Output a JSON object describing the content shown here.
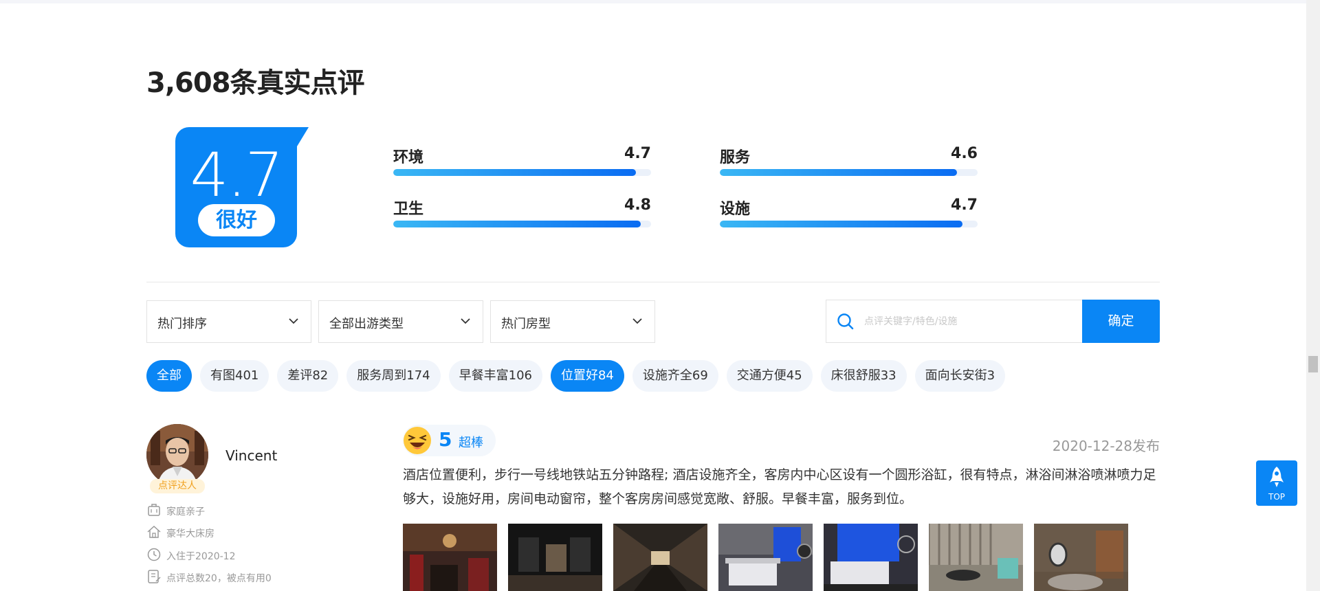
{
  "header": {
    "title": "3,608条真实点评"
  },
  "overall": {
    "score": "4.7",
    "label": "很好"
  },
  "subscores": [
    {
      "name": "环境",
      "value": "4.7",
      "fill": 0.94
    },
    {
      "name": "服务",
      "value": "4.6",
      "fill": 0.92
    },
    {
      "name": "卫生",
      "value": "4.8",
      "fill": 0.96
    },
    {
      "name": "设施",
      "value": "4.7",
      "fill": 0.94
    }
  ],
  "filters": {
    "sort": "热门排序",
    "travel_type": "全部出游类型",
    "room_type": "热门房型"
  },
  "search": {
    "placeholder": "点评关键字/特色/设施",
    "confirm_label": "确定"
  },
  "tags": [
    {
      "label": "全部",
      "active": true
    },
    {
      "label": "有图401",
      "active": false
    },
    {
      "label": "差评82",
      "active": false
    },
    {
      "label": "服务周到174",
      "active": false
    },
    {
      "label": "早餐丰富106",
      "active": false
    },
    {
      "label": "位置好84",
      "active": true
    },
    {
      "label": "设施齐全69",
      "active": false
    },
    {
      "label": "交通方便45",
      "active": false
    },
    {
      "label": "床很舒服33",
      "active": false
    },
    {
      "label": "面向长安街3",
      "active": false
    }
  ],
  "review": {
    "username": "Vincent",
    "badge": "点评达人",
    "travel_type": "家庭亲子",
    "room": "豪华大床房",
    "checkin": "入住于2020-12",
    "stats": "点评总数20，被点有用0",
    "rating": "5",
    "rating_word": "超棒",
    "date": "2020-12-28发布",
    "text": "酒店位置便利，步行一号线地铁站五分钟路程; 酒店设施齐全，客房内中心区设有一个圆形浴缸，很有特点，淋浴间淋浴喷淋喷力足够大，设施好用，房间电动窗帘，整个客房房间感觉宽敞、舒服。早餐丰富，服务到位。"
  },
  "colors": {
    "accent": "#0a86f5",
    "badge": "#f0a01e"
  },
  "back_to_top": "TOP"
}
